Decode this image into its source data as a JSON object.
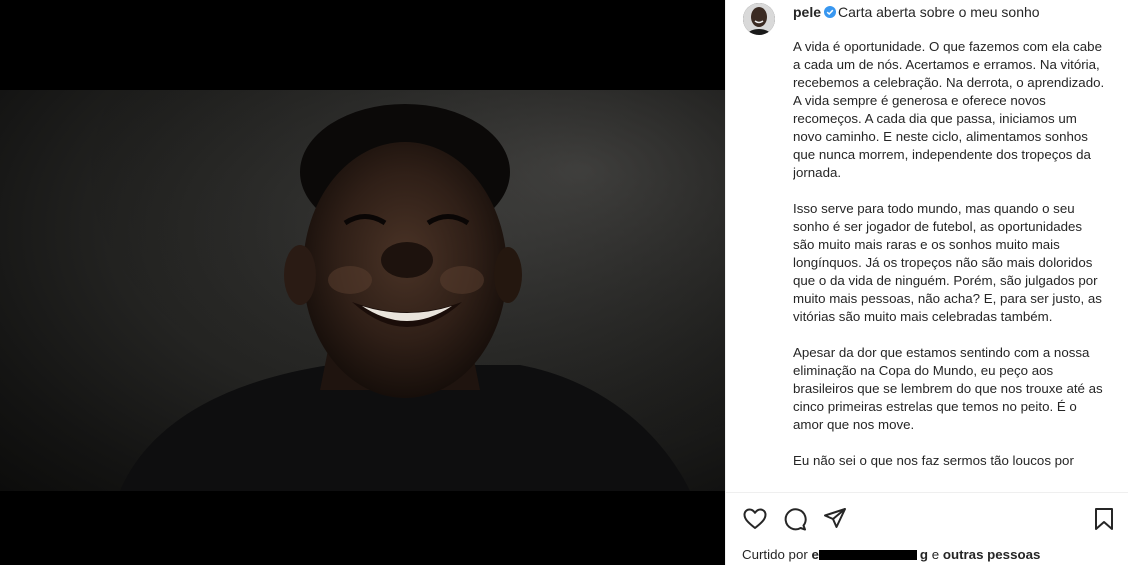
{
  "post": {
    "username": "pele",
    "title": "Carta aberta sobre o meu sonho",
    "paragraphs": [
      "A vida é oportunidade. O que fazemos com ela cabe a cada um de nós. Acertamos e erramos. Na vitória, recebemos a celebração. Na derrota, o aprendizado. A vida sempre é generosa e oferece novos recomeços. A cada dia que passa, iniciamos um novo caminho. E neste ciclo, alimentamos sonhos que nunca morrem, independente dos tropeços da jornada.",
      "Isso serve para todo mundo, mas quando o seu sonho é ser jogador de futebol, as oportunidades são muito mais raras e os sonhos muito mais longínquos. Já os tropeços não são mais doloridos que o da vida de ninguém. Porém, são julgados por muito mais pessoas, não acha? E, para ser justo, as vitórias são muito mais celebradas também.",
      "Apesar da dor que estamos sentindo com a nossa eliminação na Copa do Mundo, eu peço aos brasileiros que se lembrem do que nos trouxe até as cinco primeiras estrelas que temos no peito. É o amor que nos move.",
      "Eu não sei o que nos faz sermos tão loucos por"
    ]
  },
  "likes": {
    "prefix": "Curtido por",
    "redacted_name": "e",
    "suffix_name": "g",
    "and": "e",
    "others": "outras pessoas"
  },
  "icons": {
    "like": "heart-outline-icon",
    "comment": "comment-bubble-icon",
    "share": "paper-plane-icon",
    "save": "bookmark-icon",
    "verified": "verified-badge-icon"
  },
  "colors": {
    "text": "#262626",
    "verified": "#3897f0",
    "media_bg": "#000000"
  }
}
